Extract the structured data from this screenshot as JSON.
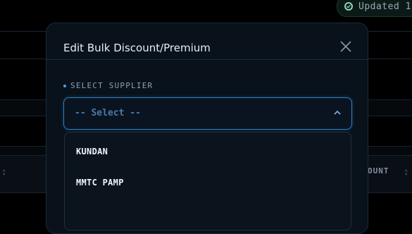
{
  "toast": {
    "icon": "check-circle-icon",
    "text": "Updated 1"
  },
  "table": {
    "column_header_partial": "OUNT"
  },
  "modal": {
    "title": "Edit Bulk Discount/Premium",
    "close_icon": "close-icon",
    "supplier_field": {
      "label": "SELECT SUPPLIER",
      "required": true,
      "value": "-- Select --",
      "options": [
        "KUNDAN",
        "MMTC PAMP"
      ]
    }
  },
  "colors": {
    "accent": "#2f80c7",
    "background": "#000000",
    "modal": "#09111a"
  }
}
